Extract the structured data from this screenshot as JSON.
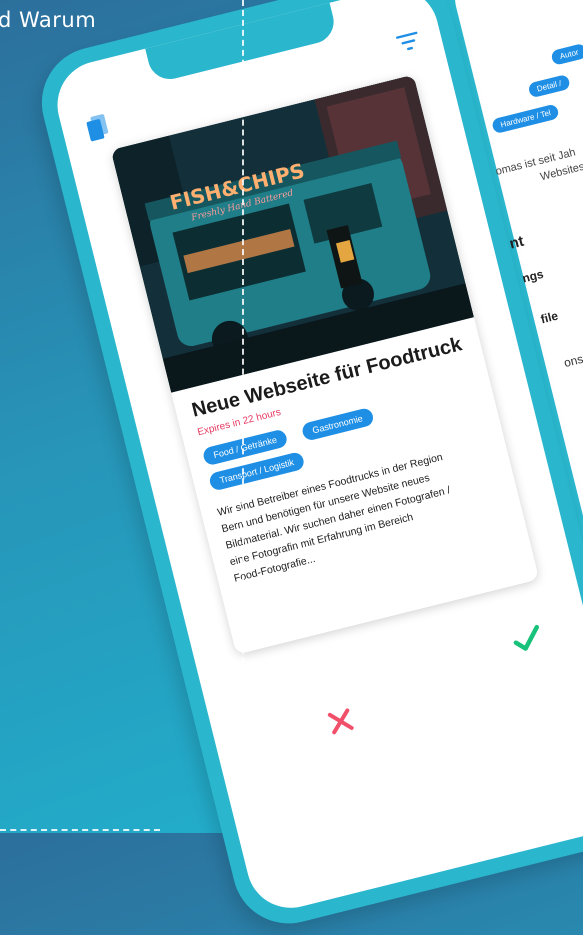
{
  "headline": "d Warum",
  "back_screen": {
    "tags": [
      "Autor",
      "Detail /",
      "Hardware / Tel"
    ],
    "text_line1": "omas ist seit Jah",
    "text_line2": "Websites p",
    "heading": "nt",
    "rows": [
      "ngs",
      "file",
      "ons and b"
    ]
  },
  "job_card": {
    "photo_sign": "FISH&CHIPS",
    "photo_subsign": "Freshly Hand Battered",
    "title": "Neue Webseite für Foodtruck",
    "expires": "Expires in 22 hours",
    "tags": [
      "Food / Getränke",
      "Gastronomie",
      "Transport / Logistik"
    ],
    "description_lines": [
      "Wir sind Betreiber eines Foodtrucks in der Region",
      "Bern und benötigen für unsere Website neues",
      "Bildmaterial. Wir suchen daher einen Fotografen /",
      "eine Fotografin mit Erfahrung im Bereich",
      "Food-Fotografie..."
    ]
  },
  "colors": {
    "accent_blue": "#1f8fe5",
    "phone_teal": "#2ab6cd",
    "expires_red": "#e53960",
    "accept_green": "#19c27a",
    "reject_red": "#f0506a"
  },
  "icons": {
    "cards": "cards-icon",
    "filter": "filter-icon",
    "reject": "close-icon",
    "accept": "check-icon"
  }
}
